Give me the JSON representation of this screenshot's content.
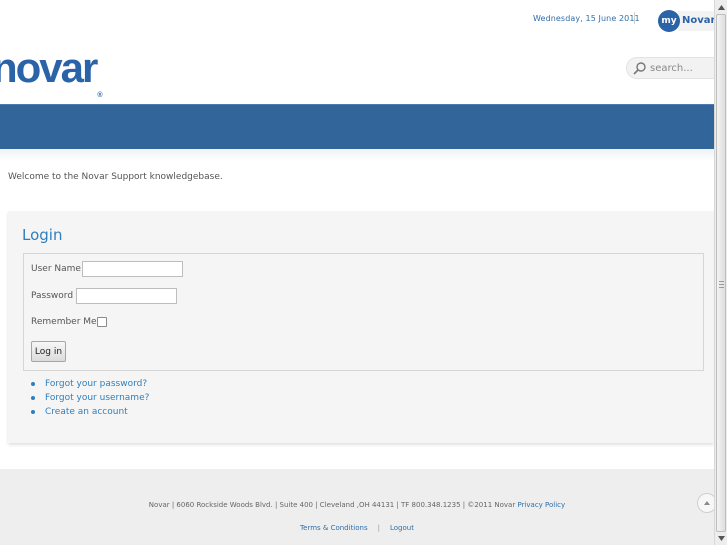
{
  "header": {
    "date": "Wednesday, 15 June 2011",
    "my_novar": {
      "my": "my",
      "brand": "Novar"
    },
    "logo": {
      "text": "novar",
      "reg": "®"
    },
    "search": {
      "placeholder": "search..."
    }
  },
  "main": {
    "welcome": "Welcome to the Novar Support knowledgebase.",
    "login": {
      "title": "Login",
      "username_label": "User Name",
      "username_value": "",
      "password_label": "Password",
      "password_value": "",
      "remember_label": "Remember Me",
      "remember_checked": false,
      "submit_label": "Log in"
    },
    "links": [
      {
        "label": "Forgot your password?"
      },
      {
        "label": "Forgot your username?"
      },
      {
        "label": "Create an account"
      }
    ]
  },
  "footer": {
    "address": "Novar | 6060 Rockside Woods Blvd. | Suite 400 | Cleveland ,OH 44131 | TF 800.348.1235 | ©2011 Novar",
    "privacy_label": "Privacy Policy",
    "terms_label": "Terms & Conditions",
    "separator": "|",
    "logout_label": "Logout"
  },
  "colors": {
    "brand_blue": "#2a63a7",
    "band_blue": "#32659a",
    "link_blue": "#2f7fbe",
    "footer_bg": "#eeeeee"
  },
  "icons": {
    "search": "magnifier-icon",
    "to_top": "arrow-up-icon"
  }
}
